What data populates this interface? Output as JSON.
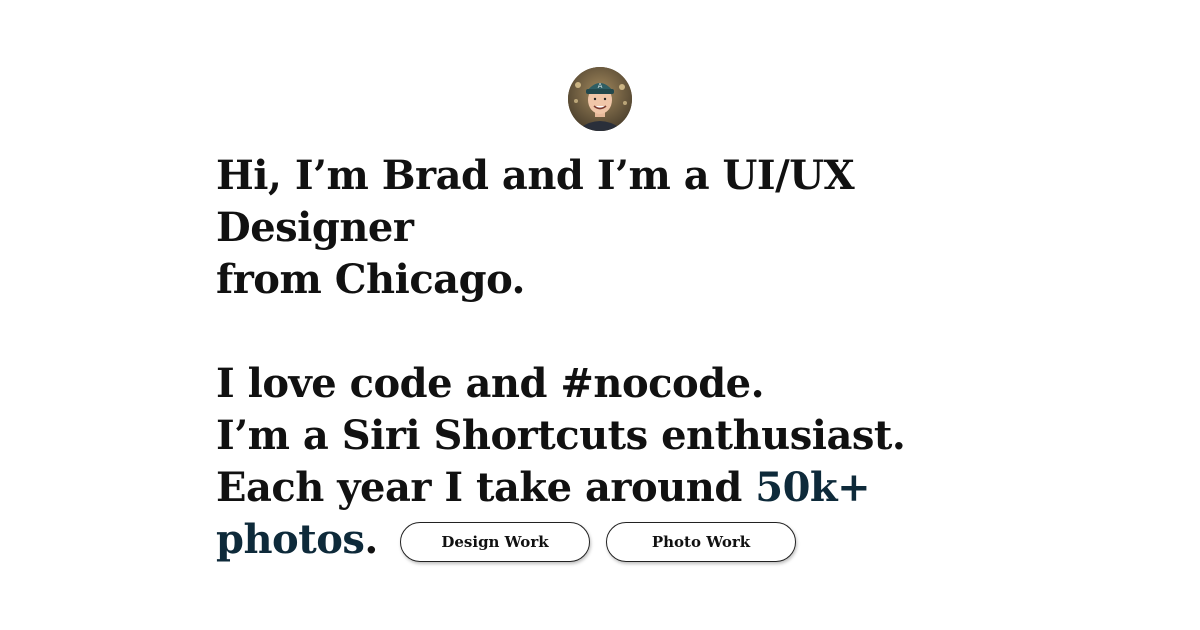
{
  "intro": {
    "line1": "Hi, I’m Brad and I’m a UI/UX Designer",
    "line2": "from Chicago.",
    "line3": "I love code and #nocode.",
    "line4": "I’m a Siri Shortcuts enthusiast.",
    "line5_prefix": "Each year I take around ",
    "line5_highlight": "50k+ photos",
    "line5_suffix": "."
  },
  "buttons": {
    "design_label": "Design Work",
    "photo_label": "Photo Work"
  },
  "colors": {
    "text": "#111111",
    "accent": "#0e2a3a",
    "background": "#ffffff"
  }
}
